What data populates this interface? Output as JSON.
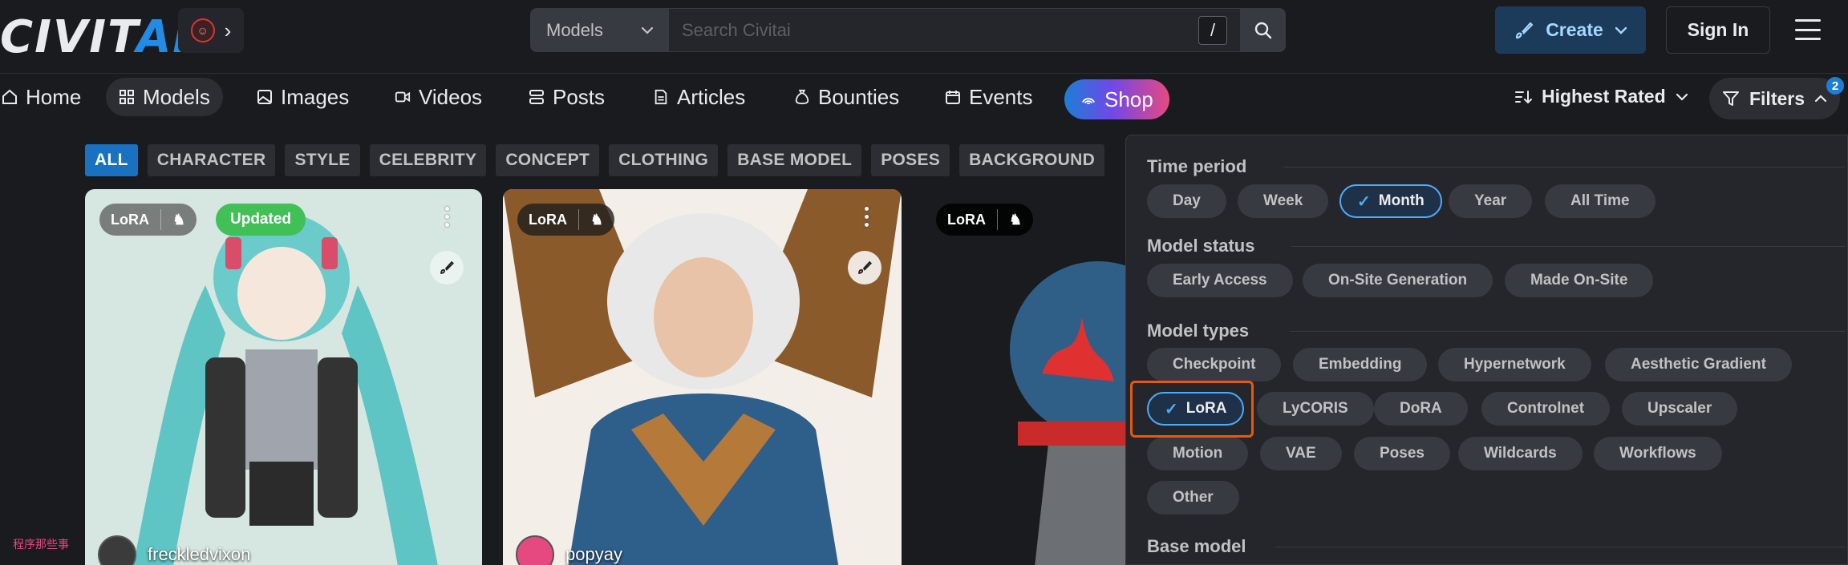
{
  "header": {
    "logo_main": "CIVIT",
    "logo_accent": "AI",
    "search_type": "Models",
    "search_placeholder": "Search Civitai",
    "search_shortcut": "/",
    "create_label": "Create",
    "signin_label": "Sign In"
  },
  "nav": {
    "items": [
      {
        "label": "Home"
      },
      {
        "label": "Models"
      },
      {
        "label": "Images"
      },
      {
        "label": "Videos"
      },
      {
        "label": "Posts"
      },
      {
        "label": "Articles"
      },
      {
        "label": "Bounties"
      },
      {
        "label": "Events"
      },
      {
        "label": "Shop"
      }
    ],
    "sort_label": "Highest Rated",
    "filters_label": "Filters",
    "filters_count": "2"
  },
  "categories": [
    "ALL",
    "CHARACTER",
    "STYLE",
    "CELEBRITY",
    "CONCEPT",
    "CLOTHING",
    "BASE MODEL",
    "POSES",
    "BACKGROUND"
  ],
  "cards": [
    {
      "type": "LoRA",
      "badge": "Updated",
      "creator": "freckledvixon"
    },
    {
      "type": "LoRA",
      "creator": "popyay"
    },
    {
      "type": "LoRA"
    }
  ],
  "filters": {
    "time_period": {
      "title": "Time period",
      "options": [
        "Day",
        "Week",
        "Month",
        "Year",
        "All Time"
      ],
      "selected": "Month"
    },
    "model_status": {
      "title": "Model status",
      "options": [
        "Early Access",
        "On-Site Generation",
        "Made On-Site"
      ]
    },
    "model_types": {
      "title": "Model types",
      "options": [
        "Checkpoint",
        "Embedding",
        "Hypernetwork",
        "Aesthetic Gradient",
        "LoRA",
        "LyCORIS",
        "DoRA",
        "Controlnet",
        "Upscaler",
        "Motion",
        "VAE",
        "Poses",
        "Wildcards",
        "Workflows",
        "Other"
      ],
      "selected": "LoRA"
    },
    "base_model": {
      "title": "Base model"
    }
  },
  "watermark": "程序那些事",
  "colors": {
    "accent": "#1971c2",
    "highlight": "#e8590c",
    "updated": "#40c057"
  }
}
